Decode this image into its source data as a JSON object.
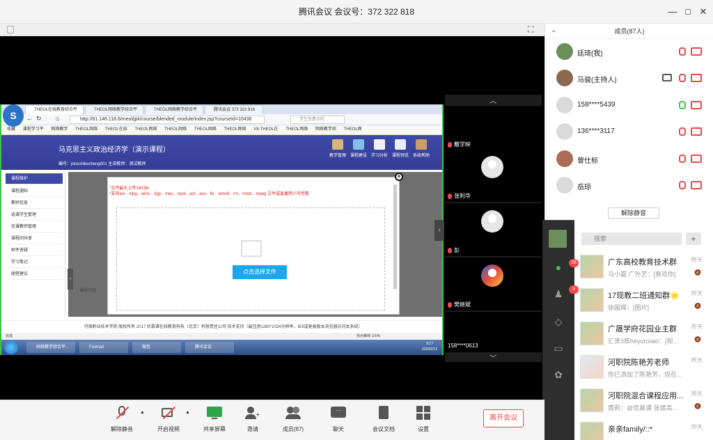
{
  "window": {
    "title": "腾讯会议 会议号：372 322 818",
    "min": "—",
    "max": "□",
    "close": "✕"
  },
  "members": {
    "header": "成员(87人)",
    "list": [
      {
        "name": "廷琦(我)",
        "mic": "muted",
        "cam": "off"
      },
      {
        "name": "马骏(主持人)",
        "mic": "muted",
        "cam": "off",
        "sharing": true
      },
      {
        "name": "158****5439",
        "mic": "on",
        "cam": "off"
      },
      {
        "name": "136****3117",
        "mic": "muted",
        "cam": "off"
      },
      {
        "name": "曾仕标",
        "mic": "muted",
        "cam": "off"
      },
      {
        "name": "岳琼",
        "mic": "muted",
        "cam": "off"
      }
    ],
    "unmute_all": "解除静音"
  },
  "video_strip": {
    "tiles": [
      {
        "name": "戴学映"
      },
      {
        "name": "张利华"
      },
      {
        "name": "彭"
      },
      {
        "name": "樊继斌"
      },
      {
        "name": "158****0613"
      }
    ]
  },
  "browser": {
    "tabs": [
      "THEOL在线教育综合平",
      "THEOL网络教学综合平",
      "THEOL网络教学综合平",
      "腾讯会议 372 322 818"
    ],
    "url": "http://61.146.118.6/meol/jpk/course/blended_module/index.jsp?courseId=10436",
    "search_placeholder": "学生免费点听",
    "favorites": [
      "收藏",
      "课程学习平",
      "网络教学",
      "THEOL网络",
      "THEOL在线",
      "THEOL网络",
      "THEOL网络",
      "THEOL网络",
      "THEOL网络",
      "V8-THEOL在",
      "THEOL网络",
      "网络教学综",
      "THEOL网"
    ]
  },
  "course": {
    "title": "马克思主义政治经济学（演示课程）",
    "code_line": "编号：ptceshikecheng001    主讲教师：测试教师",
    "nav": [
      "教学管理",
      "课程建设",
      "学习分析",
      "课程预览",
      "系统帮助"
    ],
    "side_menu": [
      "课程维护",
      "课程通知",
      "教师信息",
      "选课学生管理",
      "任课教师管理",
      "课程间共享",
      "邮件答疑",
      "学习笔记",
      "随堂建议"
    ],
    "intro": "课程介绍",
    "upload_hint1": "*文件最大上传1953M",
    "upload_hint2": "*支持avi、mpg、wmv、3gp、mov、mp4、asf、asx、flv、wmv9、rm、rmvb、mpeg 文件或直播用小写参数",
    "choose_file": "点击选择文件",
    "footer": "河源职业技术学院 版权所有 2017 优慕课在线教育科技（北京）有限责任公司 技术支持（最佳用1280*1024分辨率，IE9或更高版本浏览器访问本系统）",
    "status_left": "完成",
    "status_right": "热点推荐  100%"
  },
  "taskbar": {
    "items": [
      "网络教学综合平...",
      "Foxmail",
      "微信",
      "腾讯会议"
    ],
    "time": "9:17",
    "date": "2020/2/12"
  },
  "wechat": {
    "search": "搜索",
    "plus": "+",
    "badge_chat": "26",
    "badge_contacts": "3",
    "chats": [
      {
        "title": "广东高校教育技术群",
        "msg": "马小霜 广外艺：[喜欢你]",
        "time": "昨天"
      },
      {
        "title": "17现教二班通知群🌟",
        "msg": "徐国辉：[图片]",
        "time": "昨天"
      },
      {
        "title": "广晟学府花园业主群",
        "msg": "汇贤3栋hèyunxiao：[视...",
        "time": "昨天"
      },
      {
        "title": "河职院陈艳芳老师",
        "msg": "你已添加了陈艳芳，现在...",
        "time": "昨天"
      },
      {
        "title": "河职院混合课程应用...",
        "msg": "唐莉：@优慕课 张建高...",
        "time": "昨天"
      },
      {
        "title": "亲亲family/::*",
        "msg": "",
        "time": "昨天"
      }
    ]
  },
  "toolbar": {
    "unmute": "解除静音",
    "start_video": "开启视频",
    "share_screen": "共享屏幕",
    "invite": "邀请",
    "members": "成员(87)",
    "chat": "聊天",
    "docs": "会议文档",
    "settings": "设置",
    "leave": "离开会议"
  },
  "colors": {
    "accent_red": "#e64b4b",
    "accent_green": "#3ec24a",
    "banner": "#3e4aa8",
    "upload_button": "#1aa7ec"
  }
}
